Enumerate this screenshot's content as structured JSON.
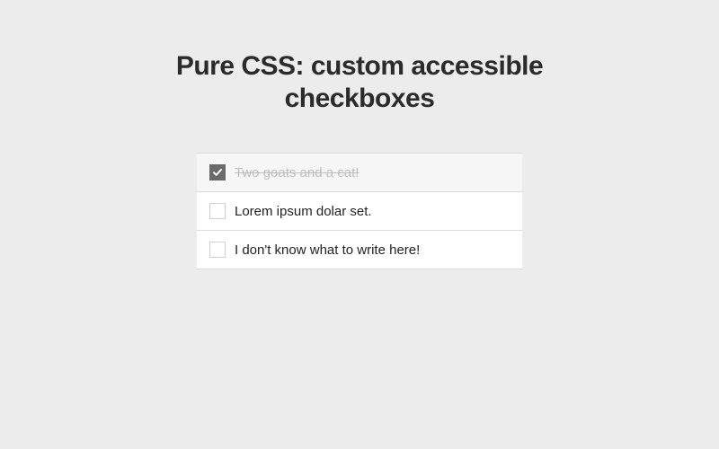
{
  "title": "Pure CSS: custom accessible checkboxes",
  "items": [
    {
      "label": "Two goats and a cat!",
      "checked": true
    },
    {
      "label": "Lorem ipsum dolar set.",
      "checked": false
    },
    {
      "label": "I don't know what to write here!",
      "checked": false
    }
  ]
}
